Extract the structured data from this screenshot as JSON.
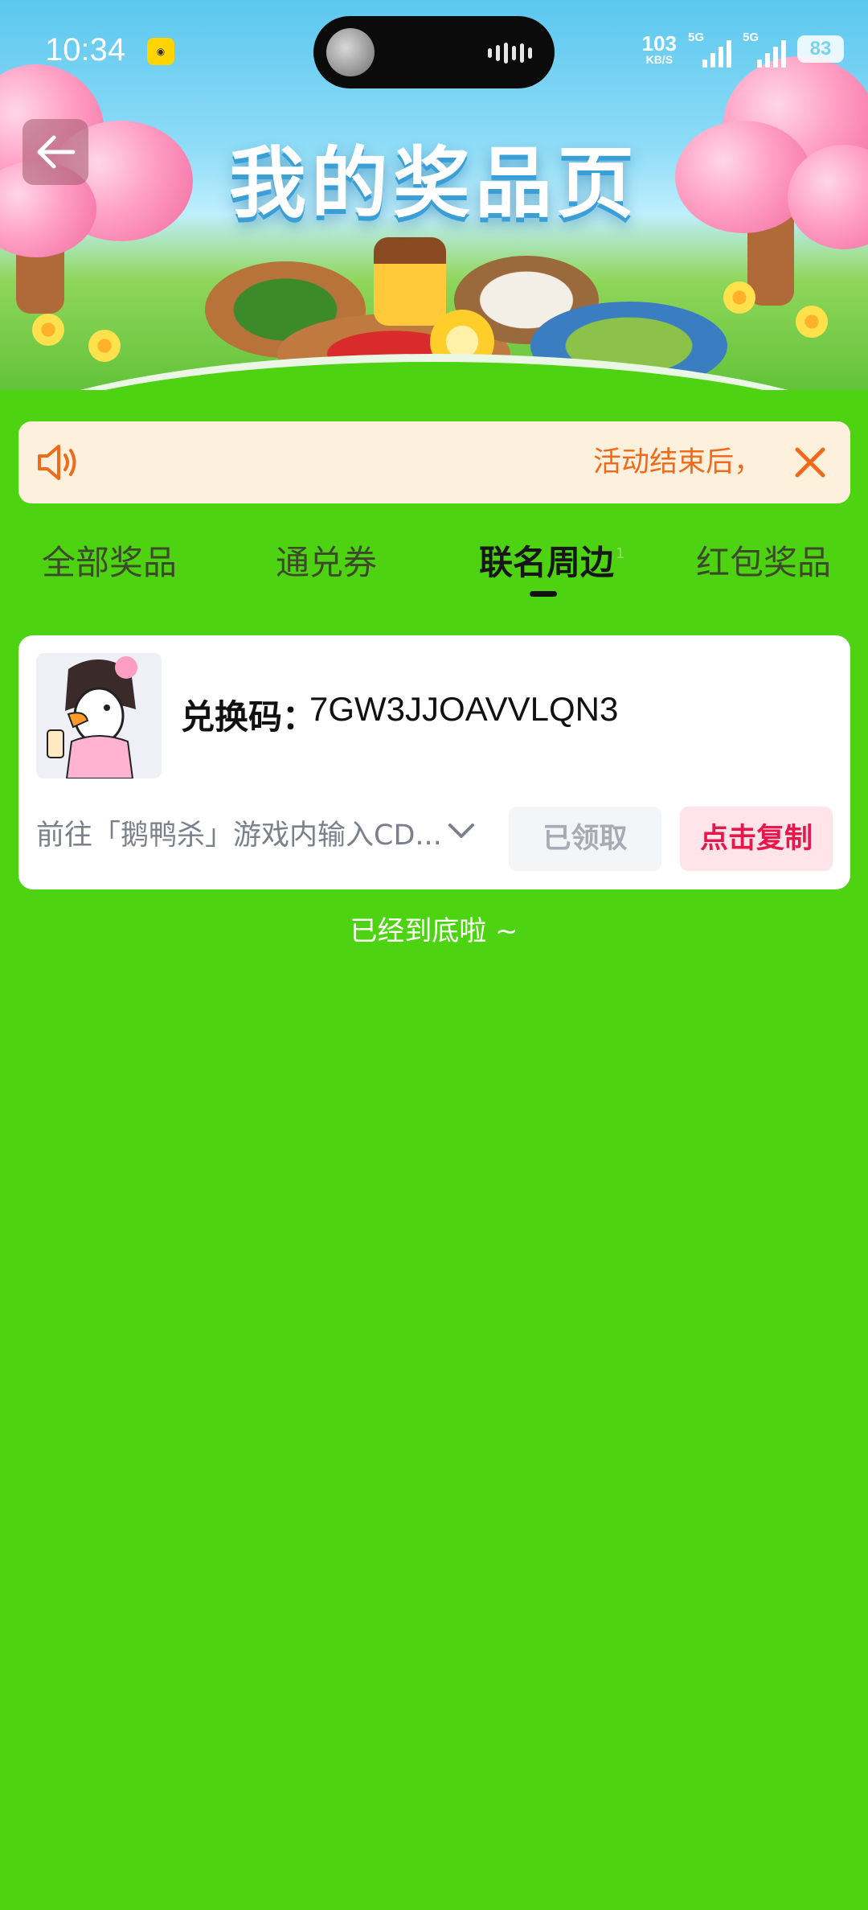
{
  "status_bar": {
    "time": "10:34",
    "net_speed_value": "103",
    "net_speed_unit": "KB/S",
    "signal1_label": "5G",
    "signal2_label": "5G",
    "battery": "83"
  },
  "banner": {
    "title": "我的奖品页"
  },
  "notice": {
    "text": "活动结束后，"
  },
  "tabs": [
    {
      "label": "全部奖品"
    },
    {
      "label": "通兑券"
    },
    {
      "label": "联名周边",
      "badge": "1",
      "active": true
    },
    {
      "label": "红包奖品"
    }
  ],
  "prize_card": {
    "code_label": "兑换码：",
    "code_value": "7GW3JJOAVVLQN3",
    "description": "前往「鹅鸭杀」游戏内输入CD...",
    "claimed_label": "已领取",
    "copy_label": "点击复制"
  },
  "footer": {
    "end_text": "已经到底啦 ~"
  },
  "colors": {
    "page_bg": "#4ed312",
    "notice_text": "#f06a1c",
    "copy_accent": "#e8174b"
  }
}
